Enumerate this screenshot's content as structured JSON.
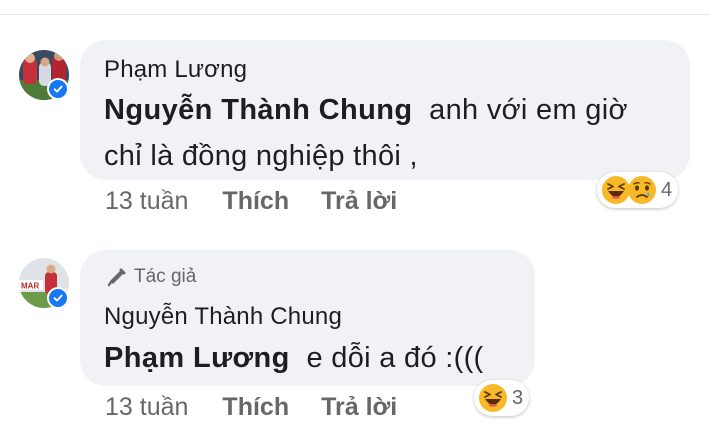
{
  "comments": [
    {
      "author": "Phạm Lương",
      "mention": "Nguyễn Thành Chung",
      "text_line1": "anh với em giờ",
      "text_line2": "chỉ là đồng nghiệp thôi ,",
      "time": "13 tuần",
      "like_label": "Thích",
      "reply_label": "Trả lời",
      "reactions": [
        "haha-icon",
        "sad-icon"
      ],
      "reaction_count": "4",
      "verified": true
    },
    {
      "badge": "Tác giả",
      "badge_icon": "megaphone-icon",
      "author": "Nguyễn Thành Chung",
      "mention": "Phạm Lương",
      "text": "e dỗi a đó :(((",
      "time": "13 tuần",
      "like_label": "Thích",
      "reply_label": "Trả lời",
      "reactions": [
        "haha-icon"
      ],
      "reaction_count": "3",
      "verified": true
    }
  ],
  "colors": {
    "bubble": "#f0f2f5",
    "meta_text": "#65676b",
    "verified_badge": "#1877f2",
    "haha_face": "#f7b928"
  }
}
